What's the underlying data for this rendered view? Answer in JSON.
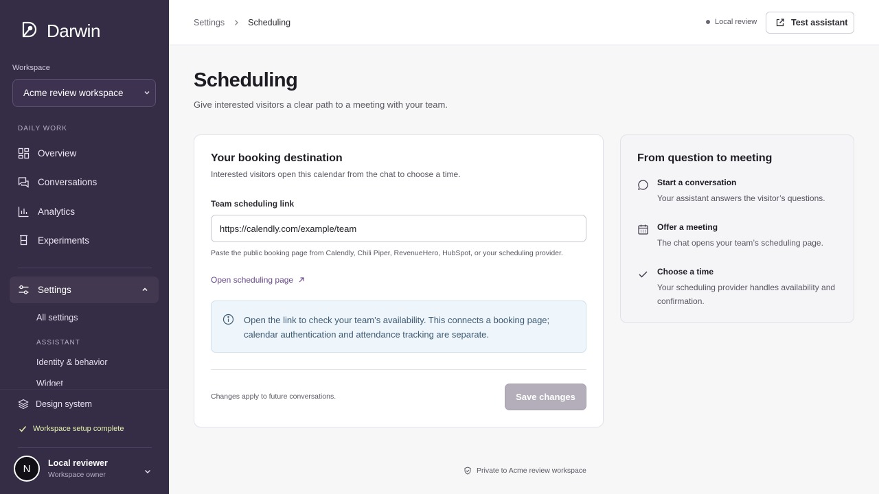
{
  "brand": {
    "name": "Darwin",
    "icon": "darwin-logo-icon"
  },
  "workspace": {
    "label": "Workspace",
    "selected": "Acme review workspace"
  },
  "sidebar": {
    "daily_work_label": "DAILY WORK",
    "items": [
      {
        "label": "Overview",
        "icon": "grid-icon"
      },
      {
        "label": "Conversations",
        "icon": "chat-icon"
      },
      {
        "label": "Analytics",
        "icon": "bar-chart-icon"
      },
      {
        "label": "Experiments",
        "icon": "beaker-icon"
      }
    ],
    "settings": {
      "label": "Settings",
      "icon": "sliders-icon"
    },
    "settings_sub": {
      "all_settings": "All settings",
      "assistant_label": "ASSISTANT",
      "identity": "Identity & behavior",
      "cut_item": "Widget"
    },
    "design_system": "Design system",
    "setup_status": "Workspace setup complete",
    "user": {
      "initial": "N",
      "name": "Local reviewer",
      "role": "Workspace owner"
    }
  },
  "topbar": {
    "breadcrumb": {
      "parent": "Settings",
      "current": "Scheduling"
    },
    "status": "Local review",
    "test_button": "Test assistant"
  },
  "page": {
    "title": "Scheduling",
    "subtitle": "Give interested visitors a clear path to a meeting with your team."
  },
  "booking": {
    "title": "Your booking destination",
    "subtitle": "Interested visitors open this calendar from the chat to choose a time.",
    "field_label": "Team scheduling link",
    "field_value": "https://calendly.com/example/team",
    "help": "Paste the public booking page from Calendly, Chili Piper, RevenueHero, HubSpot, or your scheduling provider.",
    "open_link": "Open scheduling page",
    "info": "Open the link to check your team’s availability. This connects a booking page; calendar authentication and attendance tracking are separate.",
    "footer_note": "Changes apply to future conversations.",
    "save_button": "Save changes"
  },
  "flow": {
    "title": "From question to meeting",
    "steps": [
      {
        "title": "Start a conversation",
        "desc": "Your assistant answers the visitor’s questions.",
        "icon": "chat-bubble-icon"
      },
      {
        "title": "Offer a meeting",
        "desc": "The chat opens your team’s scheduling page.",
        "icon": "calendar-icon"
      },
      {
        "title": "Choose a time",
        "desc": "Your scheduling provider handles availability and confirmation.",
        "icon": "check-icon"
      }
    ]
  },
  "footer": {
    "privacy": "Private to Acme review workspace"
  },
  "colors": {
    "sidebar_bg": "#352c45",
    "accent_link": "#6b4d8c",
    "info_bg": "#eef5fb",
    "save_disabled": "#b3aeba"
  }
}
